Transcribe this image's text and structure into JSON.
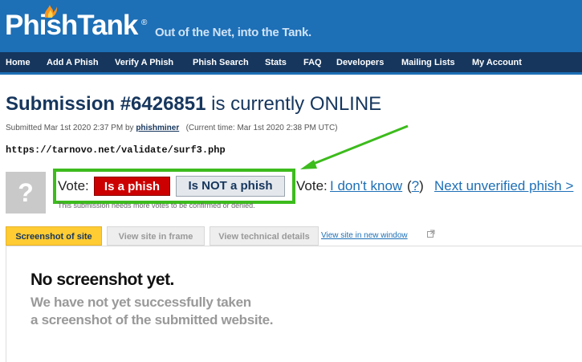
{
  "header": {
    "logo_text": "PhishTank",
    "logo_reg": "®",
    "tagline": "Out of the Net, into the Tank."
  },
  "nav": {
    "items": [
      {
        "label": "Home"
      },
      {
        "label": "Add A Phish"
      },
      {
        "label": "Verify A Phish"
      },
      {
        "label": "Phish Search"
      },
      {
        "label": "Stats"
      },
      {
        "label": "FAQ"
      },
      {
        "label": "Developers"
      },
      {
        "label": "Mailing Lists"
      },
      {
        "label": "My Account"
      }
    ]
  },
  "submission": {
    "title_prefix": "Submission #6426851",
    "title_suffix": " is currently ONLINE",
    "submitted_text": "Submitted Mar 1st 2020 2:37 PM by ",
    "submitter": "phishminer",
    "current_time": "(Current time: Mar 1st 2020 2:38 PM UTC)",
    "url": "https://tarnovo.net/validate/surf3.php"
  },
  "vote": {
    "placeholder_glyph": "?",
    "label": "Vote:",
    "is_phish": "Is a phish",
    "not_phish": "Is NOT a phish",
    "label2": "Vote:",
    "dont_know": "I don't know",
    "help_open": "(",
    "help": "?",
    "help_close": ")",
    "next": "Next unverified phish >",
    "needs_votes": "This submission needs more votes to be confirmed or denied."
  },
  "tabs": {
    "screenshot": "Screenshot of site",
    "frame": "View site in frame",
    "technical": "View technical details",
    "new_window": "View site in new window"
  },
  "screenshot_panel": {
    "heading": "No screenshot yet.",
    "line1": "We have not yet successfully taken",
    "line2": "a screenshot of the submitted website."
  },
  "colors": {
    "brand_blue": "#1d6fb6",
    "nav_navy": "#16365d",
    "highlight_green": "#3dbb1d",
    "phish_red": "#cc0000",
    "tab_yellow": "#ffcc33"
  }
}
